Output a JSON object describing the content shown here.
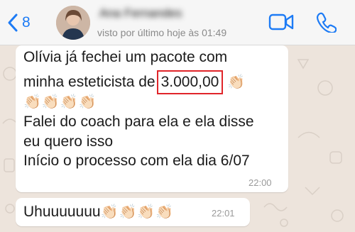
{
  "header": {
    "back_count": "8",
    "contact_name": "Ana Fernandes",
    "status": "visto por último hoje às 01:49"
  },
  "messages": [
    {
      "line1": "Olívia já fechei um pacote com",
      "line2_prefix": "minha esteticista de",
      "amount": "3.000,00",
      "clap_emoji": "👏🏻",
      "claps_line": "👏🏻👏🏻👏🏻👏🏻",
      "line4": "Falei do coach para ela e ela disse",
      "line5": "eu quero isso",
      "line6": "Início o processo com ela dia 6/07",
      "time": "22:00"
    },
    {
      "text": "Uhuuuuuuu",
      "claps": "👏🏻👏🏻👏🏻👏🏻",
      "time": "22:01"
    }
  ],
  "colors": {
    "accent": "#1d7bf5",
    "highlight_box": "#e0252a",
    "chat_bg": "#ede4dc",
    "bubble": "#ffffff"
  },
  "icons": [
    "chevron-left-icon",
    "video-call-icon",
    "phone-icon"
  ]
}
